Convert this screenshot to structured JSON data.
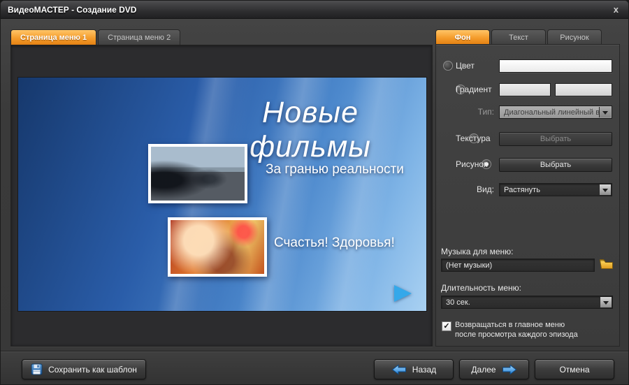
{
  "window": {
    "title": "ВидеоМАСТЕР - Создание DVD",
    "close_label": "x"
  },
  "left_tabs": [
    {
      "label": "Страница меню 1"
    },
    {
      "label": "Страница меню 2"
    }
  ],
  "right_tabs": [
    {
      "label": "Фон"
    },
    {
      "label": "Текст"
    },
    {
      "label": "Рисунок"
    }
  ],
  "preview": {
    "title": "Новые фильмы",
    "caption1": "За гранью реальности",
    "caption2": "Счастья! Здоровья!"
  },
  "settings": {
    "color_label": "Цвет",
    "gradient_label": "Градиент",
    "type_label": "Тип:",
    "type_value": "Диагональный линейный в",
    "texture_label": "Текстура",
    "texture_button": "Выбрать",
    "picture_label": "Рисунок",
    "picture_button": "Выбрать",
    "view_label": "Вид:",
    "view_value": "Растянуть",
    "music_label": "Музыка для меню:",
    "music_value": "(Нет музыки)",
    "duration_label": "Длительность меню:",
    "duration_value": "30 сек.",
    "checkbox_mark": "✓",
    "loop_line1": "Возвращаться в главное меню",
    "loop_line2": "после просмотра каждого эпизода"
  },
  "footer": {
    "save_template": "Сохранить как шаблон",
    "back": "Назад",
    "next": "Далее",
    "cancel": "Отмена"
  }
}
